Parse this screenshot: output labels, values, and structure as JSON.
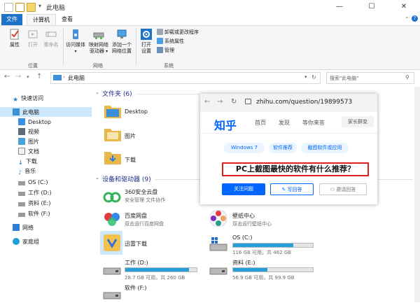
{
  "window": {
    "title": "此电脑",
    "min_symbol": "—",
    "max_symbol": "☐",
    "close_symbol": "✕"
  },
  "tabs": [
    "文件",
    "计算机",
    "查看"
  ],
  "ribbon": {
    "location": {
      "label": "位置",
      "items": [
        "属性",
        "打开",
        "重命名"
      ]
    },
    "network": {
      "label": "网络",
      "items": [
        {
          "line1": "访问媒体",
          "line2": ""
        },
        {
          "line1": "映射网络",
          "line2": "驱动器"
        },
        {
          "line1": "添加一个",
          "line2": "网络位置"
        }
      ]
    },
    "system": {
      "label": "系统",
      "open_settings": {
        "line1": "打开",
        "line2": "设置"
      },
      "small_items": [
        "卸载或更改程序",
        "系统属性",
        "管理"
      ]
    }
  },
  "address": {
    "path": "此电脑",
    "search_placeholder": "搜索\"此电脑\"",
    "back": "←",
    "forward": "→",
    "up": "↑"
  },
  "nav": [
    {
      "label": "快速访问",
      "icon": "star-icon"
    },
    {
      "label": "此电脑",
      "icon": "computer-icon"
    },
    {
      "label": "Desktop",
      "icon": "desktop-folder-icon"
    },
    {
      "label": "视频",
      "icon": "video-icon"
    },
    {
      "label": "图片",
      "icon": "picture-icon"
    },
    {
      "label": "文档",
      "icon": "document-icon"
    },
    {
      "label": "下载",
      "icon": "download-icon"
    },
    {
      "label": "音乐",
      "icon": "music-icon"
    },
    {
      "label": "OS (C:)",
      "icon": "drive-icon"
    },
    {
      "label": "工作 (D:)",
      "icon": "drive-icon"
    },
    {
      "label": "资料 (E:)",
      "icon": "drive-icon"
    },
    {
      "label": "软件 (F:)",
      "icon": "drive-icon"
    },
    {
      "label": "网络",
      "icon": "network-icon"
    },
    {
      "label": "家庭组",
      "icon": "homegroup-icon"
    }
  ],
  "folders": {
    "title": "文件夹 (6)",
    "items": [
      "Desktop",
      "图片",
      "下载"
    ]
  },
  "devices": {
    "title": "设备和驱动器 (9)",
    "items": [
      {
        "name": "360安全云盘",
        "sub": "安全管理 文件协作"
      },
      {
        "name": "百度网盘",
        "sub": "双击运行百度网盘"
      },
      {
        "name": "迅雷下载",
        "sub": ""
      },
      {
        "name": "工作 (D:)",
        "sub": "28.7 GB 可用，共 260 GB",
        "used": 0.89
      },
      {
        "name": "软件 (F:)",
        "sub": ""
      },
      {
        "name": "壁纸中心",
        "sub": "双击运行壁纸中心"
      },
      {
        "name": "OS (C:)",
        "sub": "116 GB 可用，共 462 GB",
        "used": 0.75
      },
      {
        "name": "资料 (E:)",
        "sub": "56.9 GB 可用，共 99.9 GB",
        "used": 0.43
      }
    ]
  },
  "browser": {
    "url": "zhihu.com/question/19899573",
    "logo": "知乎",
    "nav": [
      "首页",
      "发现",
      "等你来答"
    ],
    "right_btn": "家长群变",
    "tags": [
      "Windows 7",
      "软件推荐",
      "截图软件或应用"
    ],
    "question": "PC上截图最快的软件有什么推荐？",
    "follow": "关注问题",
    "answer": "写回答",
    "invite": "邀请回答"
  },
  "colors": {
    "accent": "#1e73c8",
    "zhihu_blue": "#0066ff",
    "drive_bar": "#26a0da",
    "highlight_border": "#e02020"
  }
}
